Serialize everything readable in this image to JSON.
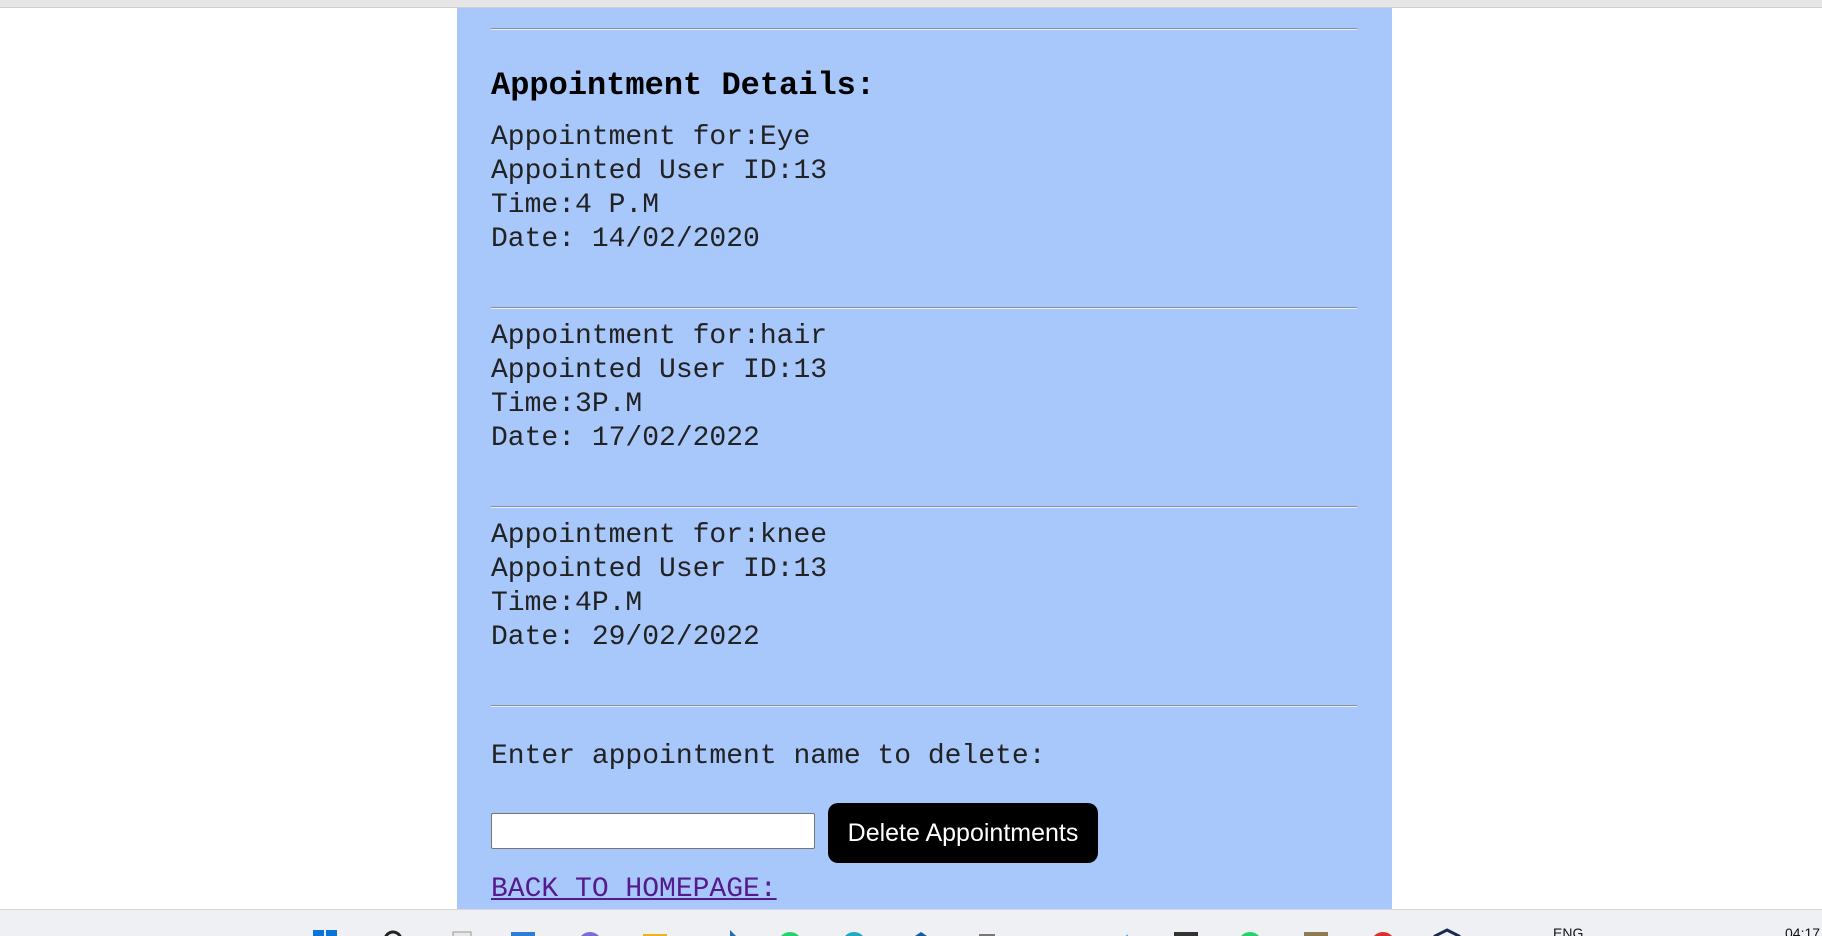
{
  "page": {
    "heading": "Appointment Details:",
    "appointments": [
      {
        "for_line": "Appointment for:Eye",
        "user_line": "Appointed User ID:13",
        "time_line": "Time:4 P.M",
        "date_line": "Date: 14/02/2020"
      },
      {
        "for_line": "Appointment for:hair",
        "user_line": "Appointed User ID:13",
        "time_line": "Time:3P.M",
        "date_line": "Date: 17/02/2022"
      },
      {
        "for_line": "Appointment for:knee",
        "user_line": "Appointed User ID:13",
        "time_line": "Time:4P.M",
        "date_line": "Date: 29/02/2022"
      }
    ],
    "delete_prompt": "Enter appointment name to delete:",
    "delete_input_value": "",
    "delete_button_label": "Delete Appointments",
    "back_link_label": "BACK TO HOMEPAGE:"
  },
  "colors": {
    "panel_background": "#a8c7fa",
    "button_background": "#000000",
    "link_color": "#551a8b"
  },
  "taskbar": {
    "language": "ENG",
    "clock": "04:17",
    "icons": [
      "windows-start-icon",
      "search-icon",
      "file-icon",
      "widgets-icon",
      "chat-icon",
      "folder-icon",
      "app-icon",
      "whatsapp-icon",
      "browser-icon",
      "vscode-icon",
      "settings-icon",
      "folder-icon",
      "app-icon",
      "app-icon",
      "whatsapp-icon",
      "app-icon",
      "red-app-icon",
      "shield-icon"
    ]
  }
}
